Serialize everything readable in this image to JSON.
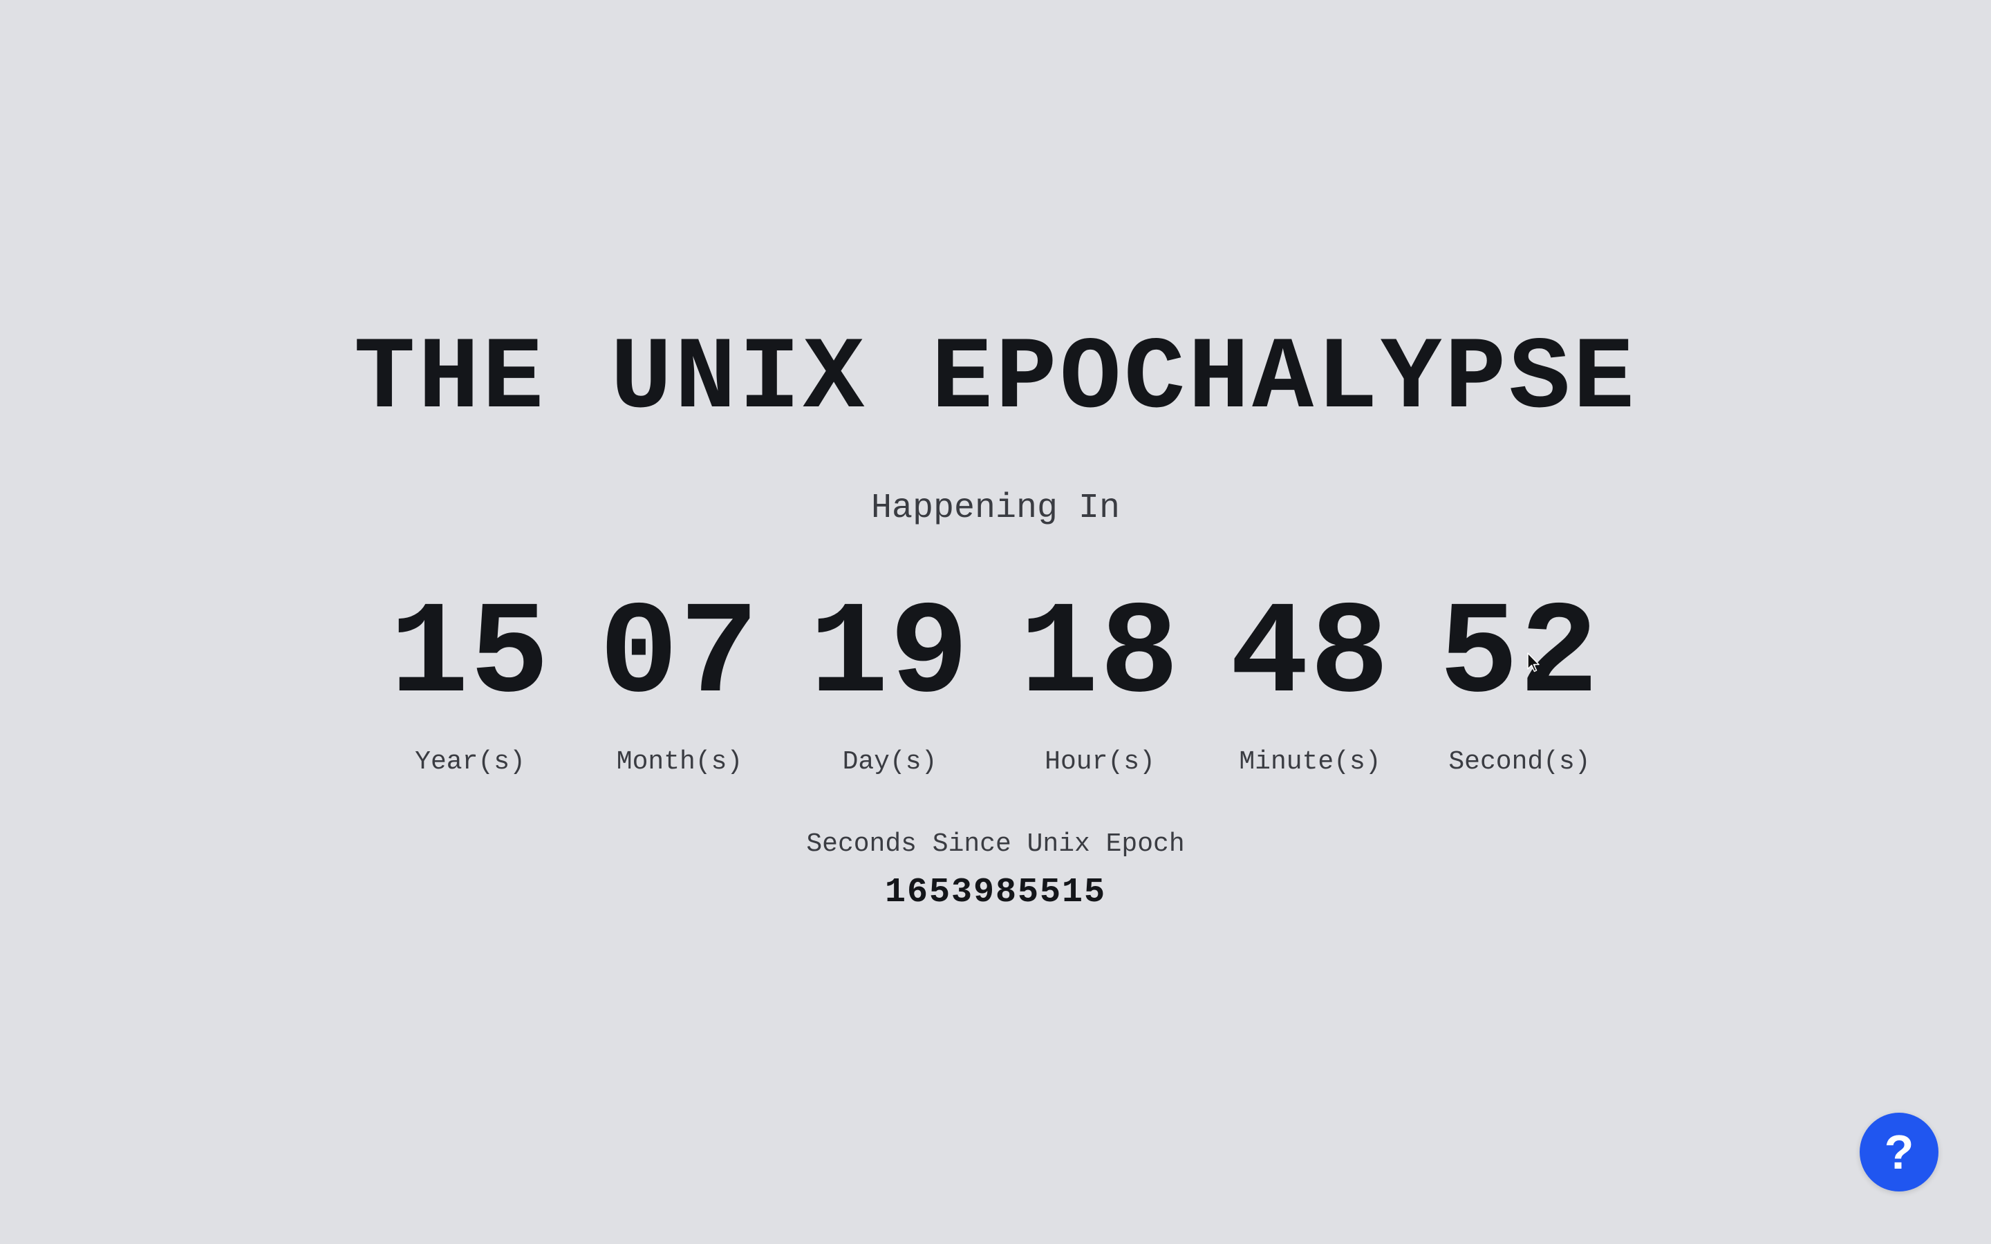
{
  "title": "THE UNIX EPOCHALYPSE",
  "subtitle": "Happening In",
  "countdown": [
    {
      "value": "15",
      "label": "Year(s)"
    },
    {
      "value": "07",
      "label": "Month(s)"
    },
    {
      "value": "19",
      "label": "Day(s)"
    },
    {
      "value": "18",
      "label": "Hour(s)"
    },
    {
      "value": "48",
      "label": "Minute(s)"
    },
    {
      "value": "52",
      "label": "Second(s)"
    }
  ],
  "epoch": {
    "label": "Seconds Since Unix Epoch",
    "value": "1653985515"
  },
  "help_button": {
    "label": "?",
    "icon": "question-mark-icon",
    "color": "#2056f0"
  },
  "colors": {
    "background": "#dfe0e4",
    "text": "#14161a",
    "muted_text": "#3a3c42"
  }
}
